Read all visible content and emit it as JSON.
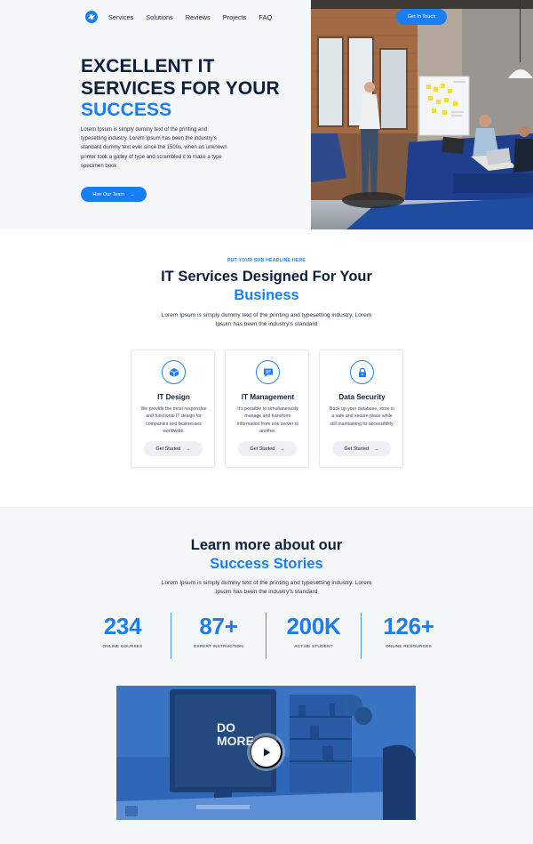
{
  "nav": {
    "items": [
      "Services",
      "Solutions",
      "Reviews",
      "Projects",
      "FAQ"
    ],
    "cta_label": "Get In Touch"
  },
  "hero": {
    "title_line1": "EXCELLENT IT",
    "title_line2": "SERVICES FOR YOUR",
    "title_accent": "SUCCESS",
    "text": "Lorem Ipsum is simply dummy text of the printing and typesetting industry. Lorem Ipsum has been the industry's standard dummy text ever since the 1500s, when an unknown printer took a galley of type and scrambled it to make a type specimen book",
    "button_label": "Hire Our Team",
    "button_arrow": "→"
  },
  "services": {
    "sub_headline": "PUT YOUR SUB HEADLINE HERE",
    "title": "IT Services Designed For Your",
    "title_accent": "Business",
    "description": "Lorem Ipsum is simply dummy text of the printing and typesetting industry. Lorem Ipsum has been the industry's standard",
    "cards": [
      {
        "icon": "cube-icon",
        "title": "IT Design",
        "text": "We provide the most responsive and functional IT design for companies and businesses worldwide.",
        "button_label": "Get Started",
        "button_arrow": "→"
      },
      {
        "icon": "chat-icon",
        "title": "IT Management",
        "text": "It's possible to simultaneously manage and transform information from one server to another.",
        "button_label": "Get Started",
        "button_arrow": "→"
      },
      {
        "icon": "lock-icon",
        "title": "Data Security",
        "text": "Back up your database, store in a safe and secure place while still maintaining its accessibility.",
        "button_label": "Get Started",
        "button_arrow": "→"
      }
    ]
  },
  "stories": {
    "title": "Learn more about our",
    "title_accent": "Success Stories",
    "description": "Lorem Ipsum is simply dummy text of the printing and typesetting industry. Lorem Ipsum has been the industry's standard",
    "stats": [
      {
        "value": "234",
        "label": "ONLINE COURSES"
      },
      {
        "value": "87+",
        "label": "EXPERT INSTRUCTION"
      },
      {
        "value": "200K",
        "label": "ACTIVE STUDENT"
      },
      {
        "value": "126+",
        "label": "ONLINE RESOURCES"
      }
    ],
    "video_screen_text_1": "DO",
    "video_screen_text_2": "MORE."
  },
  "colors": {
    "accent": "#1a7ef0",
    "navy": "#0f1f3d",
    "light_bg": "#f6f7f9"
  }
}
